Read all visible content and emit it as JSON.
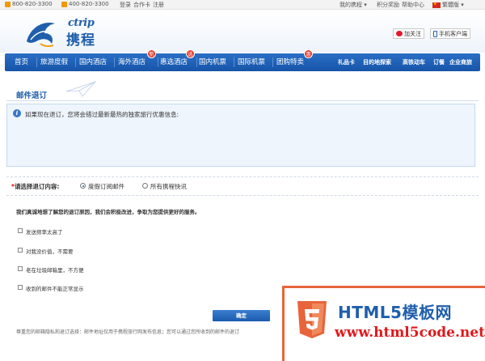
{
  "topbar": {
    "phone1": "800-820-3300",
    "phone2": "400-820-3300",
    "login": "登录",
    "card": "合作卡",
    "register": "注册",
    "my_ctrip": "我的携程",
    "points": "积分奖励",
    "help": "帮助中心",
    "lang": "繁體版"
  },
  "header": {
    "logo_en": "ctrip",
    "logo_cn": "携程",
    "follow": "加关注",
    "mobile": "手机客户端"
  },
  "nav": {
    "items": [
      "首页",
      "旅游度假",
      "国内酒店",
      "海外酒店",
      "惠选酒店",
      "国内机票",
      "国际机票",
      "团购特卖"
    ],
    "badges": [
      "新",
      "选",
      "惠"
    ],
    "right_items": [
      "礼品卡",
      "目的地探索",
      "高铁动车",
      "订餐",
      "企业商旅"
    ]
  },
  "page": {
    "title": "邮件退订",
    "info_text": "如果现在退订，您将会错过最新最热的独家旅行优惠信息:",
    "option_label": "请选择退订内容:",
    "option_required": "*",
    "options": [
      "度假订阅邮件",
      "所有携程快讯"
    ],
    "reason_intro": "我们真诚地想了解您的退订原因，我们会积极改进，争取为您提供更好的服务。",
    "reasons": [
      "发送频率太高了",
      "对我没价值，不需要",
      "老在垃圾邮箱里，不方便",
      "收到的邮件不能正常显示"
    ],
    "confirm": "确定",
    "footer_note": "尊重您的邮箱隐私和退订选择：邮件地址仅用于携程旅行网发布信息；您可以通过您所收到的邮件的退订"
  },
  "watermark": {
    "line1": "HTML5模板网",
    "line2": "www.html5code.net"
  },
  "colors": {
    "brand": "#1f5fab",
    "nav": "#1a5cb0",
    "badge": "#e8352a"
  }
}
